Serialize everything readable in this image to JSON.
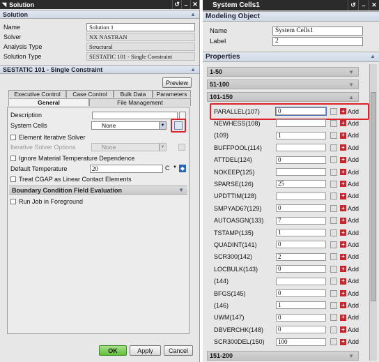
{
  "left": {
    "title": "Solution",
    "section_solution": "Solution",
    "fields": [
      {
        "label": "Name",
        "value": "Solution 1"
      },
      {
        "label": "Solver",
        "value": "NX NASTRAN"
      },
      {
        "label": "Analysis Type",
        "value": "Structural"
      },
      {
        "label": "Solution Type",
        "value": "SESTATIC 101 - Single Constraint"
      }
    ],
    "section_sestatic": "SESTATIC 101 - Single Constraint",
    "preview_label": "Preview",
    "tabs_row1": [
      "Executive Control",
      "Case Control",
      "Bulk Data",
      "Parameters"
    ],
    "tabs_row2": [
      "General",
      "File Management"
    ],
    "description_label": "Description",
    "system_cells_label": "System Cells",
    "system_cells_value": "None",
    "element_iterative_label": "Element Iterative Solver",
    "iterative_options_label": "Iterative Solver Options",
    "iterative_options_value": "None",
    "ignore_material_label": "Ignore Material Temperature Dependence",
    "default_temp_label": "Default Temperature",
    "default_temp_value": "20",
    "default_temp_unit": "C",
    "treat_cgap_label": "Treat CGAP as Linear Contact Elements",
    "boundary_section": "Boundary Condition Field Evaluation",
    "run_job_label": "Run Job in Foreground",
    "ok_label": "OK",
    "apply_label": "Apply",
    "cancel_label": "Cancel"
  },
  "right": {
    "title": "System Cells1",
    "modeling_section": "Modeling Object",
    "name_label": "Name",
    "name_value": "System Cells1",
    "label_label": "Label",
    "label_value": "2",
    "properties_section": "Properties",
    "groups": [
      "1-50",
      "51-100",
      "101-150",
      "151-200"
    ],
    "add_label": "Add",
    "rows": [
      {
        "name": "PARALLEL(107)",
        "value": "0"
      },
      {
        "name": "NEWHESS(108)",
        "value": ""
      },
      {
        "name": "(109)",
        "value": "1"
      },
      {
        "name": "BUFFPOOL(114)",
        "value": ""
      },
      {
        "name": "ATTDEL(124)",
        "value": "0"
      },
      {
        "name": "NOKEEP(125)",
        "value": ""
      },
      {
        "name": "SPARSE(126)",
        "value": "25"
      },
      {
        "name": "UPDTTIM(128)",
        "value": ""
      },
      {
        "name": "SMPYAD67(129)",
        "value": "0"
      },
      {
        "name": "AUTOASGN(133)",
        "value": "7"
      },
      {
        "name": "TSTAMP(135)",
        "value": "1"
      },
      {
        "name": "QUADINT(141)",
        "value": "0"
      },
      {
        "name": "SCR300(142)",
        "value": "2"
      },
      {
        "name": "LOCBULK(143)",
        "value": "0"
      },
      {
        "name": "(144)",
        "value": ""
      },
      {
        "name": "BFGS(145)",
        "value": "0"
      },
      {
        "name": "(146)",
        "value": "1"
      },
      {
        "name": "UWM(147)",
        "value": "0"
      },
      {
        "name": "DBVERCHK(148)",
        "value": "0"
      },
      {
        "name": "SCR300DEL(150)",
        "value": "100"
      }
    ]
  }
}
